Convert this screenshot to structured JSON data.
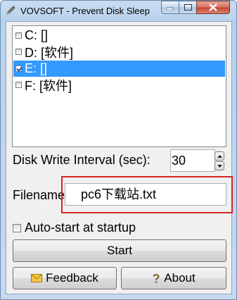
{
  "window": {
    "title": "VOVSOFT - Prevent Disk Sleep"
  },
  "drives": [
    {
      "label": "C: []",
      "checked": false,
      "selected": false
    },
    {
      "label": "D: [软件]",
      "checked": false,
      "selected": false
    },
    {
      "label": "E: []",
      "checked": true,
      "selected": true
    },
    {
      "label": "F: [软件]",
      "checked": false,
      "selected": false
    }
  ],
  "interval": {
    "label": "Disk Write Interval (sec):",
    "value": "30"
  },
  "filename": {
    "label": "Filename:",
    "value": "pc6下载站.txt"
  },
  "autostart": {
    "label": "Auto-start at startup",
    "checked": false
  },
  "buttons": {
    "start_label": "Start",
    "feedback_label": "Feedback",
    "about_label": "About"
  },
  "icons": {
    "app": "pencil-icon",
    "feedback": "envelope-icon",
    "about": "question-icon"
  },
  "colors": {
    "selection": "#3399ff",
    "highlight_box": "#d42525",
    "close_button": "#c4452f"
  }
}
